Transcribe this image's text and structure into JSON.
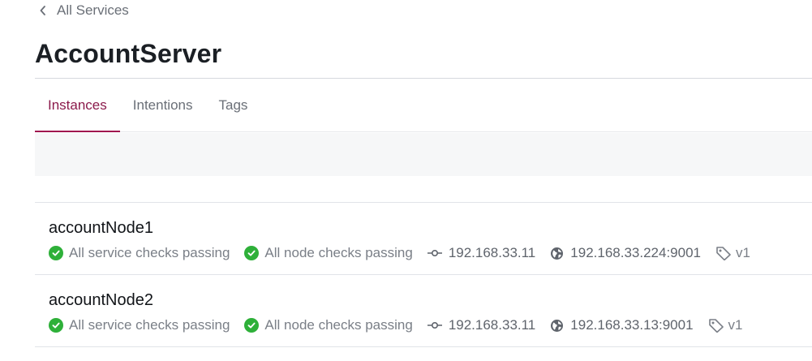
{
  "breadcrumb": {
    "label": "All Services"
  },
  "service": {
    "name": "AccountServer"
  },
  "tabs": [
    {
      "label": "Instances",
      "active": true
    },
    {
      "label": "Intentions",
      "active": false
    },
    {
      "label": "Tags",
      "active": false
    }
  ],
  "instances": [
    {
      "name": "accountNode1",
      "service_checks": "All service checks passing",
      "node_checks": "All node checks passing",
      "node_address": "192.168.33.11",
      "service_address": "192.168.33.224:9001",
      "tag": "v1"
    },
    {
      "name": "accountNode2",
      "service_checks": "All service checks passing",
      "node_checks": "All node checks passing",
      "node_address": "192.168.33.11",
      "service_address": "192.168.33.13:9001",
      "tag": "v1"
    }
  ],
  "icons": {
    "back": "chevron-left-icon",
    "passing": "check-circle-icon",
    "node_address": "commit-node-icon",
    "service_address": "globe-icon",
    "tag": "tag-icon"
  },
  "colors": {
    "accent": "#a0174f",
    "passing": "#2eb039",
    "muted_text": "#7a7f87",
    "filter_bg": "#f6f7f8"
  }
}
